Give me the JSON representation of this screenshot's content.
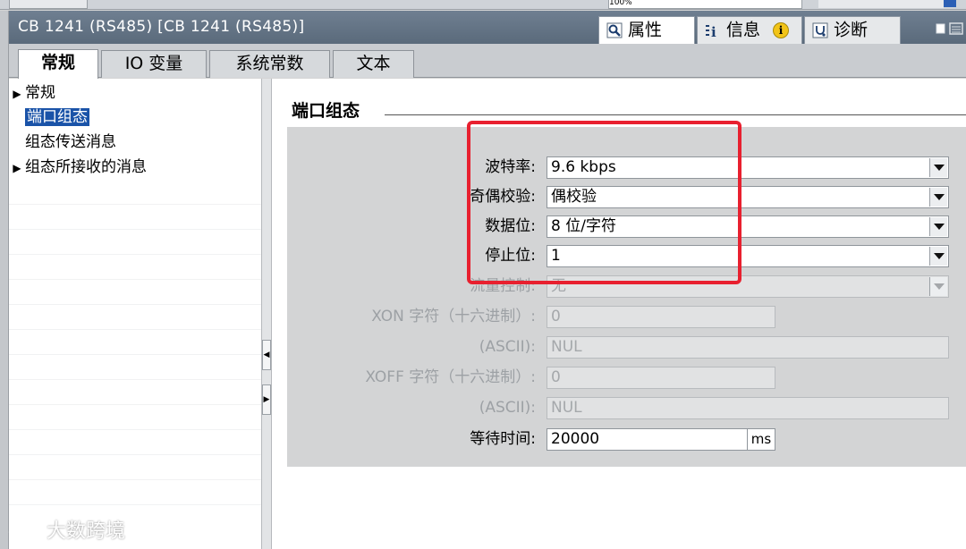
{
  "topbar": {
    "zoom_value": "100%"
  },
  "window": {
    "title": "CB 1241 (RS485) [CB 1241 (RS485)]"
  },
  "panel_tabs": [
    {
      "label": "属性",
      "icon": "magnifier-properties-icon"
    },
    {
      "label": "信息",
      "icon": "info-list-icon",
      "badge": "i"
    },
    {
      "label": "诊断",
      "icon": "diagnostics-icon"
    }
  ],
  "tabs": [
    {
      "label": "常规"
    },
    {
      "label": "IO 变量"
    },
    {
      "label": "系统常数"
    },
    {
      "label": "文本"
    }
  ],
  "nav": {
    "items": [
      {
        "label": "常规",
        "expandable": true
      },
      {
        "label": "端口组态",
        "selected": true
      },
      {
        "label": "组态传送消息"
      },
      {
        "label": "组态所接收的消息",
        "expandable": true
      }
    ]
  },
  "section": {
    "title": "端口组态"
  },
  "form": {
    "baud": {
      "label": "波特率:",
      "value": "9.6 kbps"
    },
    "parity": {
      "label": "奇偶校验:",
      "value": "偶校验"
    },
    "databits": {
      "label": "数据位:",
      "value": "8 位/字符"
    },
    "stopbits": {
      "label": "停止位:",
      "value": "1"
    },
    "flow": {
      "label": "流量控制:",
      "value": "无"
    },
    "xon_hex": {
      "label": "XON 字符（十六进制）:",
      "value": "0"
    },
    "xon_ascii": {
      "label": "(ASCII):",
      "value": "NUL"
    },
    "xoff_hex": {
      "label": "XOFF 字符（十六进制）:",
      "value": "0"
    },
    "xoff_ascii": {
      "label": "(ASCII):",
      "value": "NUL"
    },
    "wait": {
      "label": "等待时间:",
      "value": "20000",
      "unit": "ms"
    }
  },
  "colors": {
    "highlight": "#e8202f",
    "selection": "#1a53a8",
    "titlebar": "#637385"
  },
  "watermark": {
    "text": "大数跨境"
  }
}
